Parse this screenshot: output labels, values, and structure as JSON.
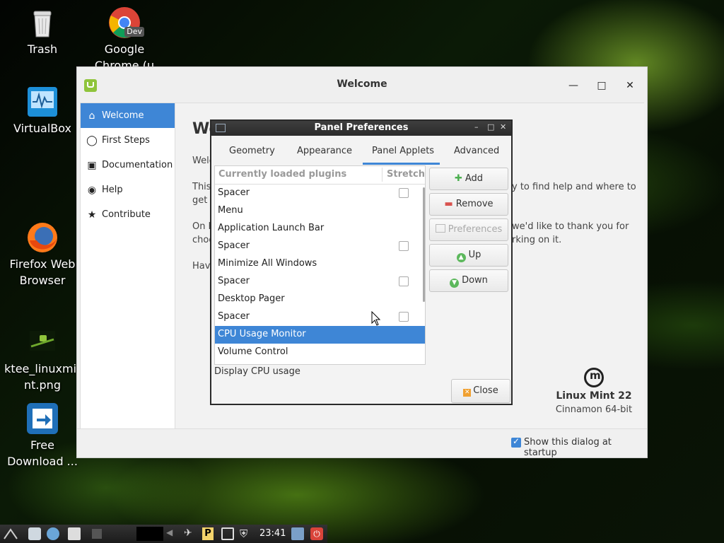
{
  "desktop": {
    "icons": [
      {
        "label": "Trash",
        "icon": "trash-icon"
      },
      {
        "label": "Google\nChrome (u",
        "icon": "chrome-dev-icon",
        "badge": "Dev"
      },
      {
        "label": "VirtualBox",
        "icon": "virtualbox-icon"
      },
      {
        "label": "Firefox Web\nBrowser",
        "icon": "firefox-icon"
      },
      {
        "label": "ktee_linuxmi-\nnt.png",
        "icon": "image-file-icon"
      },
      {
        "label": "Free\nDownload ...",
        "icon": "free-download-icon"
      }
    ]
  },
  "welcome_window": {
    "title": "Welcome",
    "sidebar": [
      {
        "label": "Welcome",
        "icon": "home-icon",
        "active": true
      },
      {
        "label": "First Steps",
        "icon": "lightbulb-icon"
      },
      {
        "label": "Documentation",
        "icon": "book-icon"
      },
      {
        "label": "Help",
        "icon": "lifebuoy-icon"
      },
      {
        "label": "Contribute",
        "icon": "star-icon"
      }
    ],
    "heading": "We",
    "paragraphs": [
      "Welc",
      "This",
      "get",
      "y to find help and where to",
      "On b",
      "choo",
      "we'd like to thank you for",
      "rking on it.",
      "Hav"
    ],
    "brand_name": "Linux Mint 22",
    "brand_edition": "Cinnamon 64-bit",
    "show_on_startup_label": "Show this dialog at startup",
    "show_on_startup_checked": true
  },
  "panel_prefs": {
    "title": "Panel Preferences",
    "tabs": [
      "Geometry",
      "Appearance",
      "Panel Applets",
      "Advanced"
    ],
    "active_tab": "Panel Applets",
    "columns": {
      "plugins": "Currently loaded plugins",
      "stretch": "Stretch"
    },
    "rows": [
      {
        "name": "Spacer",
        "has_stretch": true,
        "stretch": false
      },
      {
        "name": "Menu",
        "has_stretch": false
      },
      {
        "name": "Application Launch Bar",
        "has_stretch": false
      },
      {
        "name": "Spacer",
        "has_stretch": true,
        "stretch": false
      },
      {
        "name": "Minimize All Windows",
        "has_stretch": false
      },
      {
        "name": "Spacer",
        "has_stretch": true,
        "stretch": false
      },
      {
        "name": "Desktop Pager",
        "has_stretch": false
      },
      {
        "name": "Spacer",
        "has_stretch": true,
        "stretch": false
      },
      {
        "name": "CPU Usage Monitor",
        "has_stretch": false,
        "selected": true
      },
      {
        "name": "Volume Control",
        "has_stretch": false
      }
    ],
    "buttons": {
      "add": "Add",
      "remove": "Remove",
      "preferences": "Preferences",
      "up": "Up",
      "down": "Down",
      "close": "Close"
    },
    "description": "Display CPU usage"
  },
  "taskbar": {
    "clock": "23:41"
  },
  "colors": {
    "accent": "#3e86d6",
    "mint_green": "#8fc43b"
  }
}
